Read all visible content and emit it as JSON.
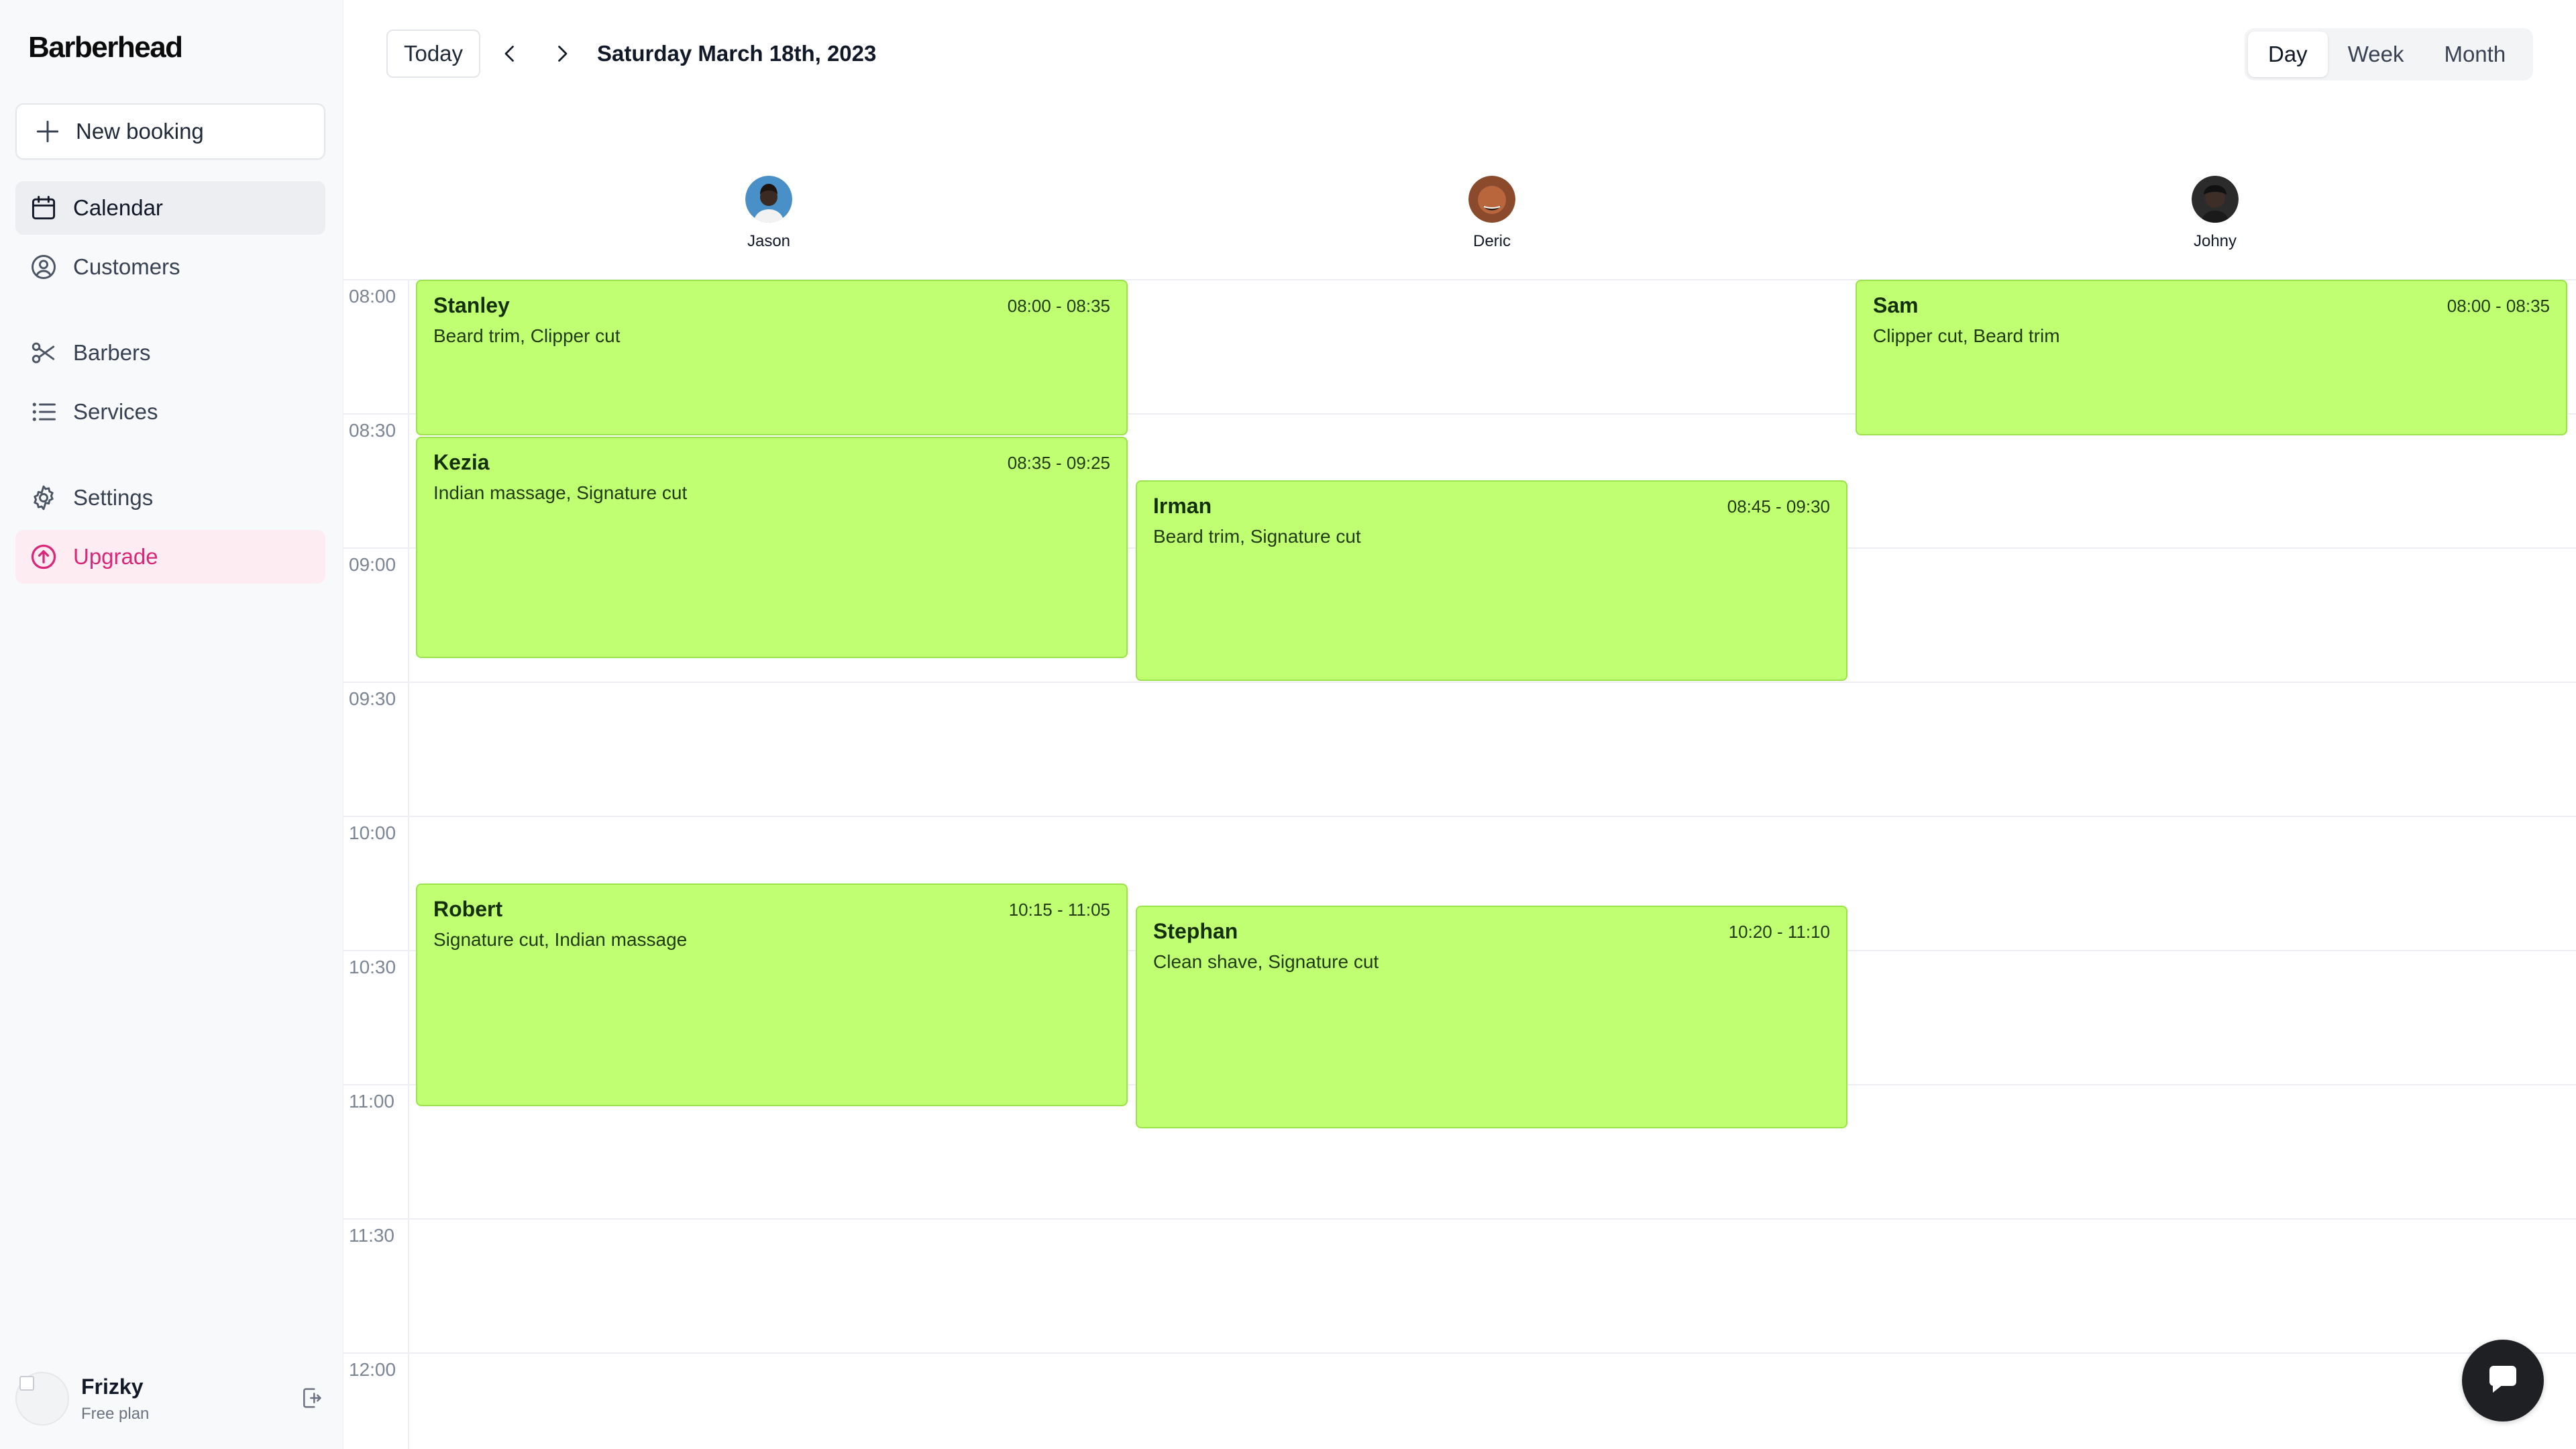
{
  "sidebar": {
    "brand": "Barberhead",
    "new_booking": "New booking",
    "nav": [
      {
        "label": "Calendar",
        "icon": "calendar-icon",
        "active": true
      },
      {
        "label": "Customers",
        "icon": "user-circle-icon"
      },
      {
        "label": "Barbers",
        "icon": "scissors-icon"
      },
      {
        "label": "Services",
        "icon": "list-icon"
      },
      {
        "label": "Settings",
        "icon": "gear-icon"
      },
      {
        "label": "Upgrade",
        "icon": "arrow-up-circle-icon"
      }
    ],
    "user": {
      "name": "Frizky",
      "plan": "Free plan"
    }
  },
  "toolbar": {
    "today": "Today",
    "date": "Saturday March 18th, 2023",
    "views": [
      "Day",
      "Week",
      "Month"
    ],
    "active_view": "Day"
  },
  "barbers": [
    {
      "name": "Jason",
      "avatar_color": "#4a90c8"
    },
    {
      "name": "Deric",
      "avatar_color": "#8b4a2b"
    },
    {
      "name": "Johny",
      "avatar_color": "#2b2b2b"
    }
  ],
  "times": [
    "08:00",
    "08:30",
    "09:00",
    "09:30",
    "10:00",
    "10:30",
    "11:00",
    "11:30",
    "12:00"
  ],
  "events": [
    {
      "name": "Stanley",
      "time": "08:00 - 08:35",
      "services": "Beard trim, Clipper cut"
    },
    {
      "name": "Kezia",
      "time": "08:35 - 09:25",
      "services": "Indian massage, Signature cut"
    },
    {
      "name": "Robert",
      "time": "10:15 - 11:05",
      "services": "Signature cut, Indian massage"
    },
    {
      "name": "Irman",
      "time": "08:45 - 09:30",
      "services": "Beard trim, Signature cut"
    },
    {
      "name": "Stephan",
      "time": "10:20 - 11:10",
      "services": "Clean shave, Signature cut"
    },
    {
      "name": "Sam",
      "time": "08:00 - 08:35",
      "services": "Clipper cut, Beard trim"
    }
  ],
  "colors": {
    "event_bg": "#c1ff72",
    "event_border": "#9be34b",
    "upgrade": "#db2777"
  }
}
